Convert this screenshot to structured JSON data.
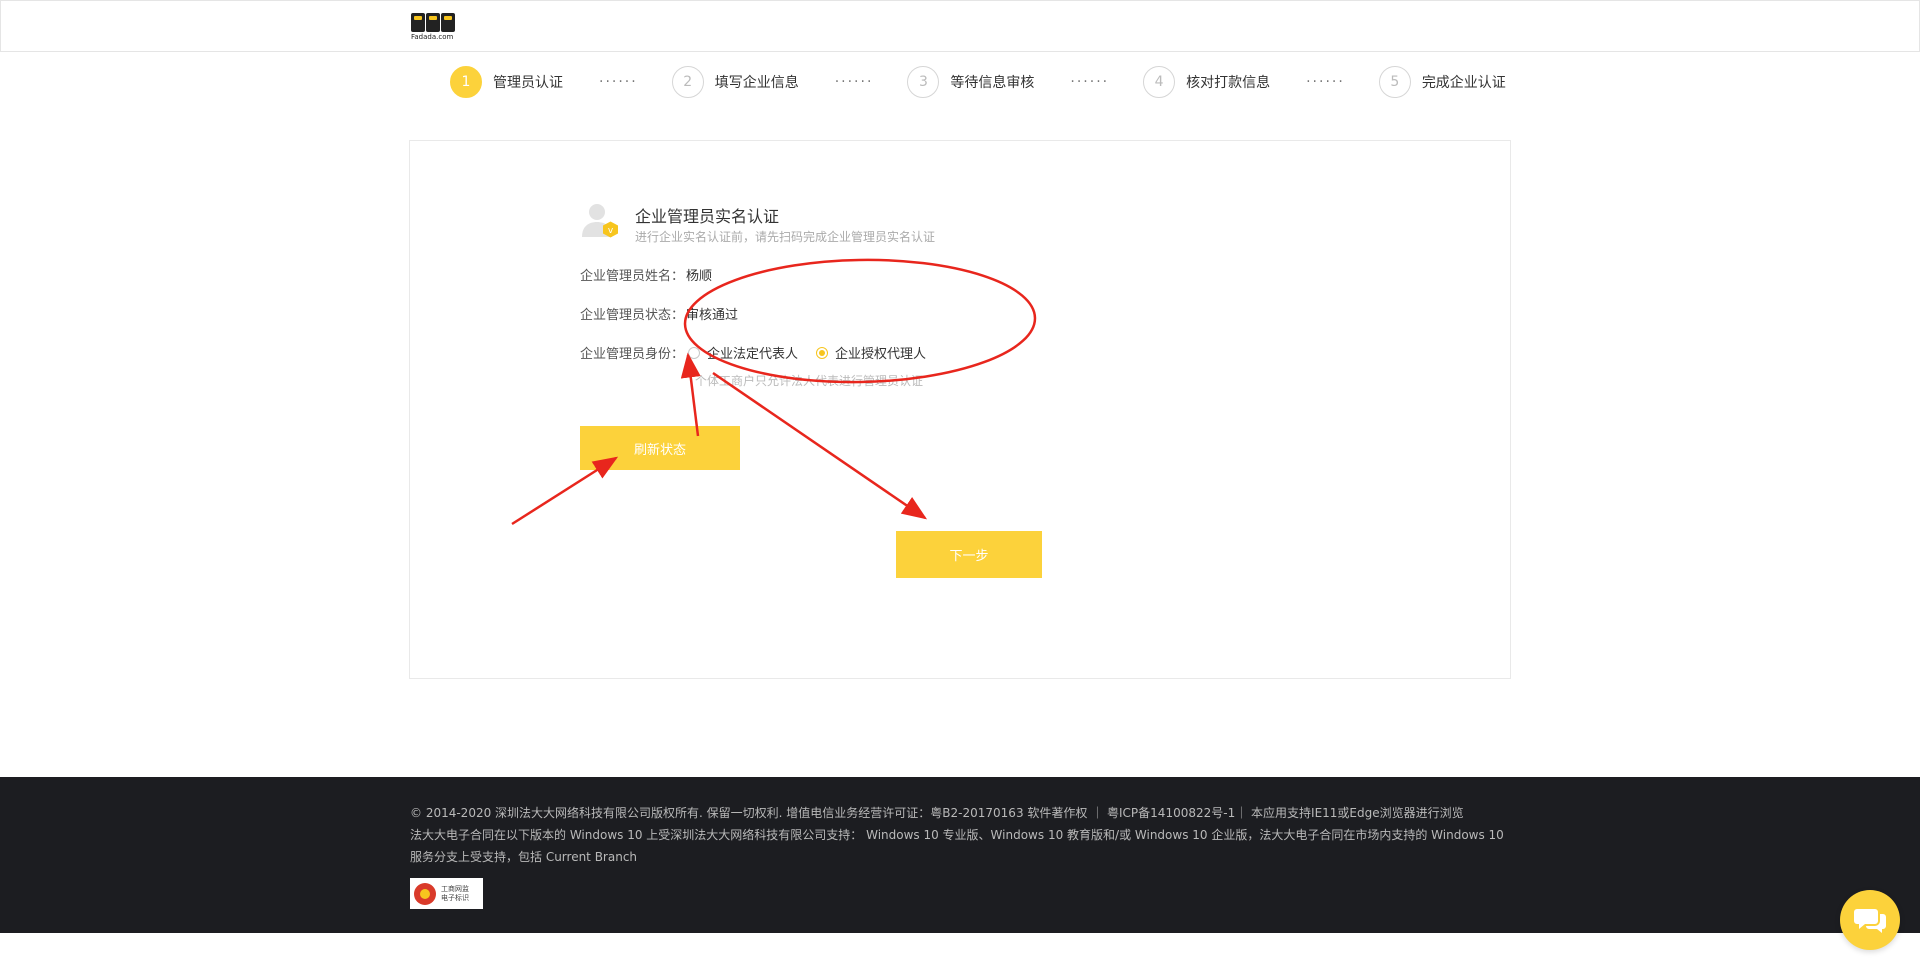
{
  "brand": {
    "logo_text": "Fadada.com"
  },
  "steps": [
    {
      "num": "1",
      "label": "管理员认证"
    },
    {
      "num": "2",
      "label": "填写企业信息"
    },
    {
      "num": "3",
      "label": "等待信息审核"
    },
    {
      "num": "4",
      "label": "核对打款信息"
    },
    {
      "num": "5",
      "label": "完成企业认证"
    }
  ],
  "step_dots": "······",
  "card": {
    "title": "企业管理员实名认证",
    "subtitle": "进行企业实名认证前，请先扫码完成企业管理员实名认证",
    "name_label": "企业管理员姓名：",
    "name_value": "杨顺",
    "status_label": "企业管理员状态：",
    "status_value": "审核通过",
    "identity_label": "企业管理员身份：",
    "identity_options": [
      {
        "label": "企业法定代表人",
        "checked": false
      },
      {
        "label": "企业授权代理人",
        "checked": true
      }
    ],
    "hint": "个体工商户只允许法人代表进行管理员认证",
    "refresh_button": "刷新状态",
    "next_button": "下一步"
  },
  "footer": {
    "line1": "© 2014-2020 深圳法大大网络科技有限公司版权所有. 保留一切权利. 增值电信业务经营许可证：粤B2-20170163 软件著作权 ｜ 粤ICP备14100822号-1｜ 本应用支持IE11或Edge浏览器进行浏览",
    "line2": "法大大电子合同在以下版本的 Windows 10 上受深圳法大大网络科技有限公司支持： Windows 10 专业版、Windows 10 教育版和/或 Windows 10 企业版，法大大电子合同在市场内支持的 Windows 10 服务分支上受支持，包括 Current Branch",
    "badge_line1": "工商网监",
    "badge_line2": "电子标识"
  },
  "colors": {
    "accent": "#fcd23b",
    "annotation": "#e8261d",
    "footer_bg": "#1c1d21"
  }
}
